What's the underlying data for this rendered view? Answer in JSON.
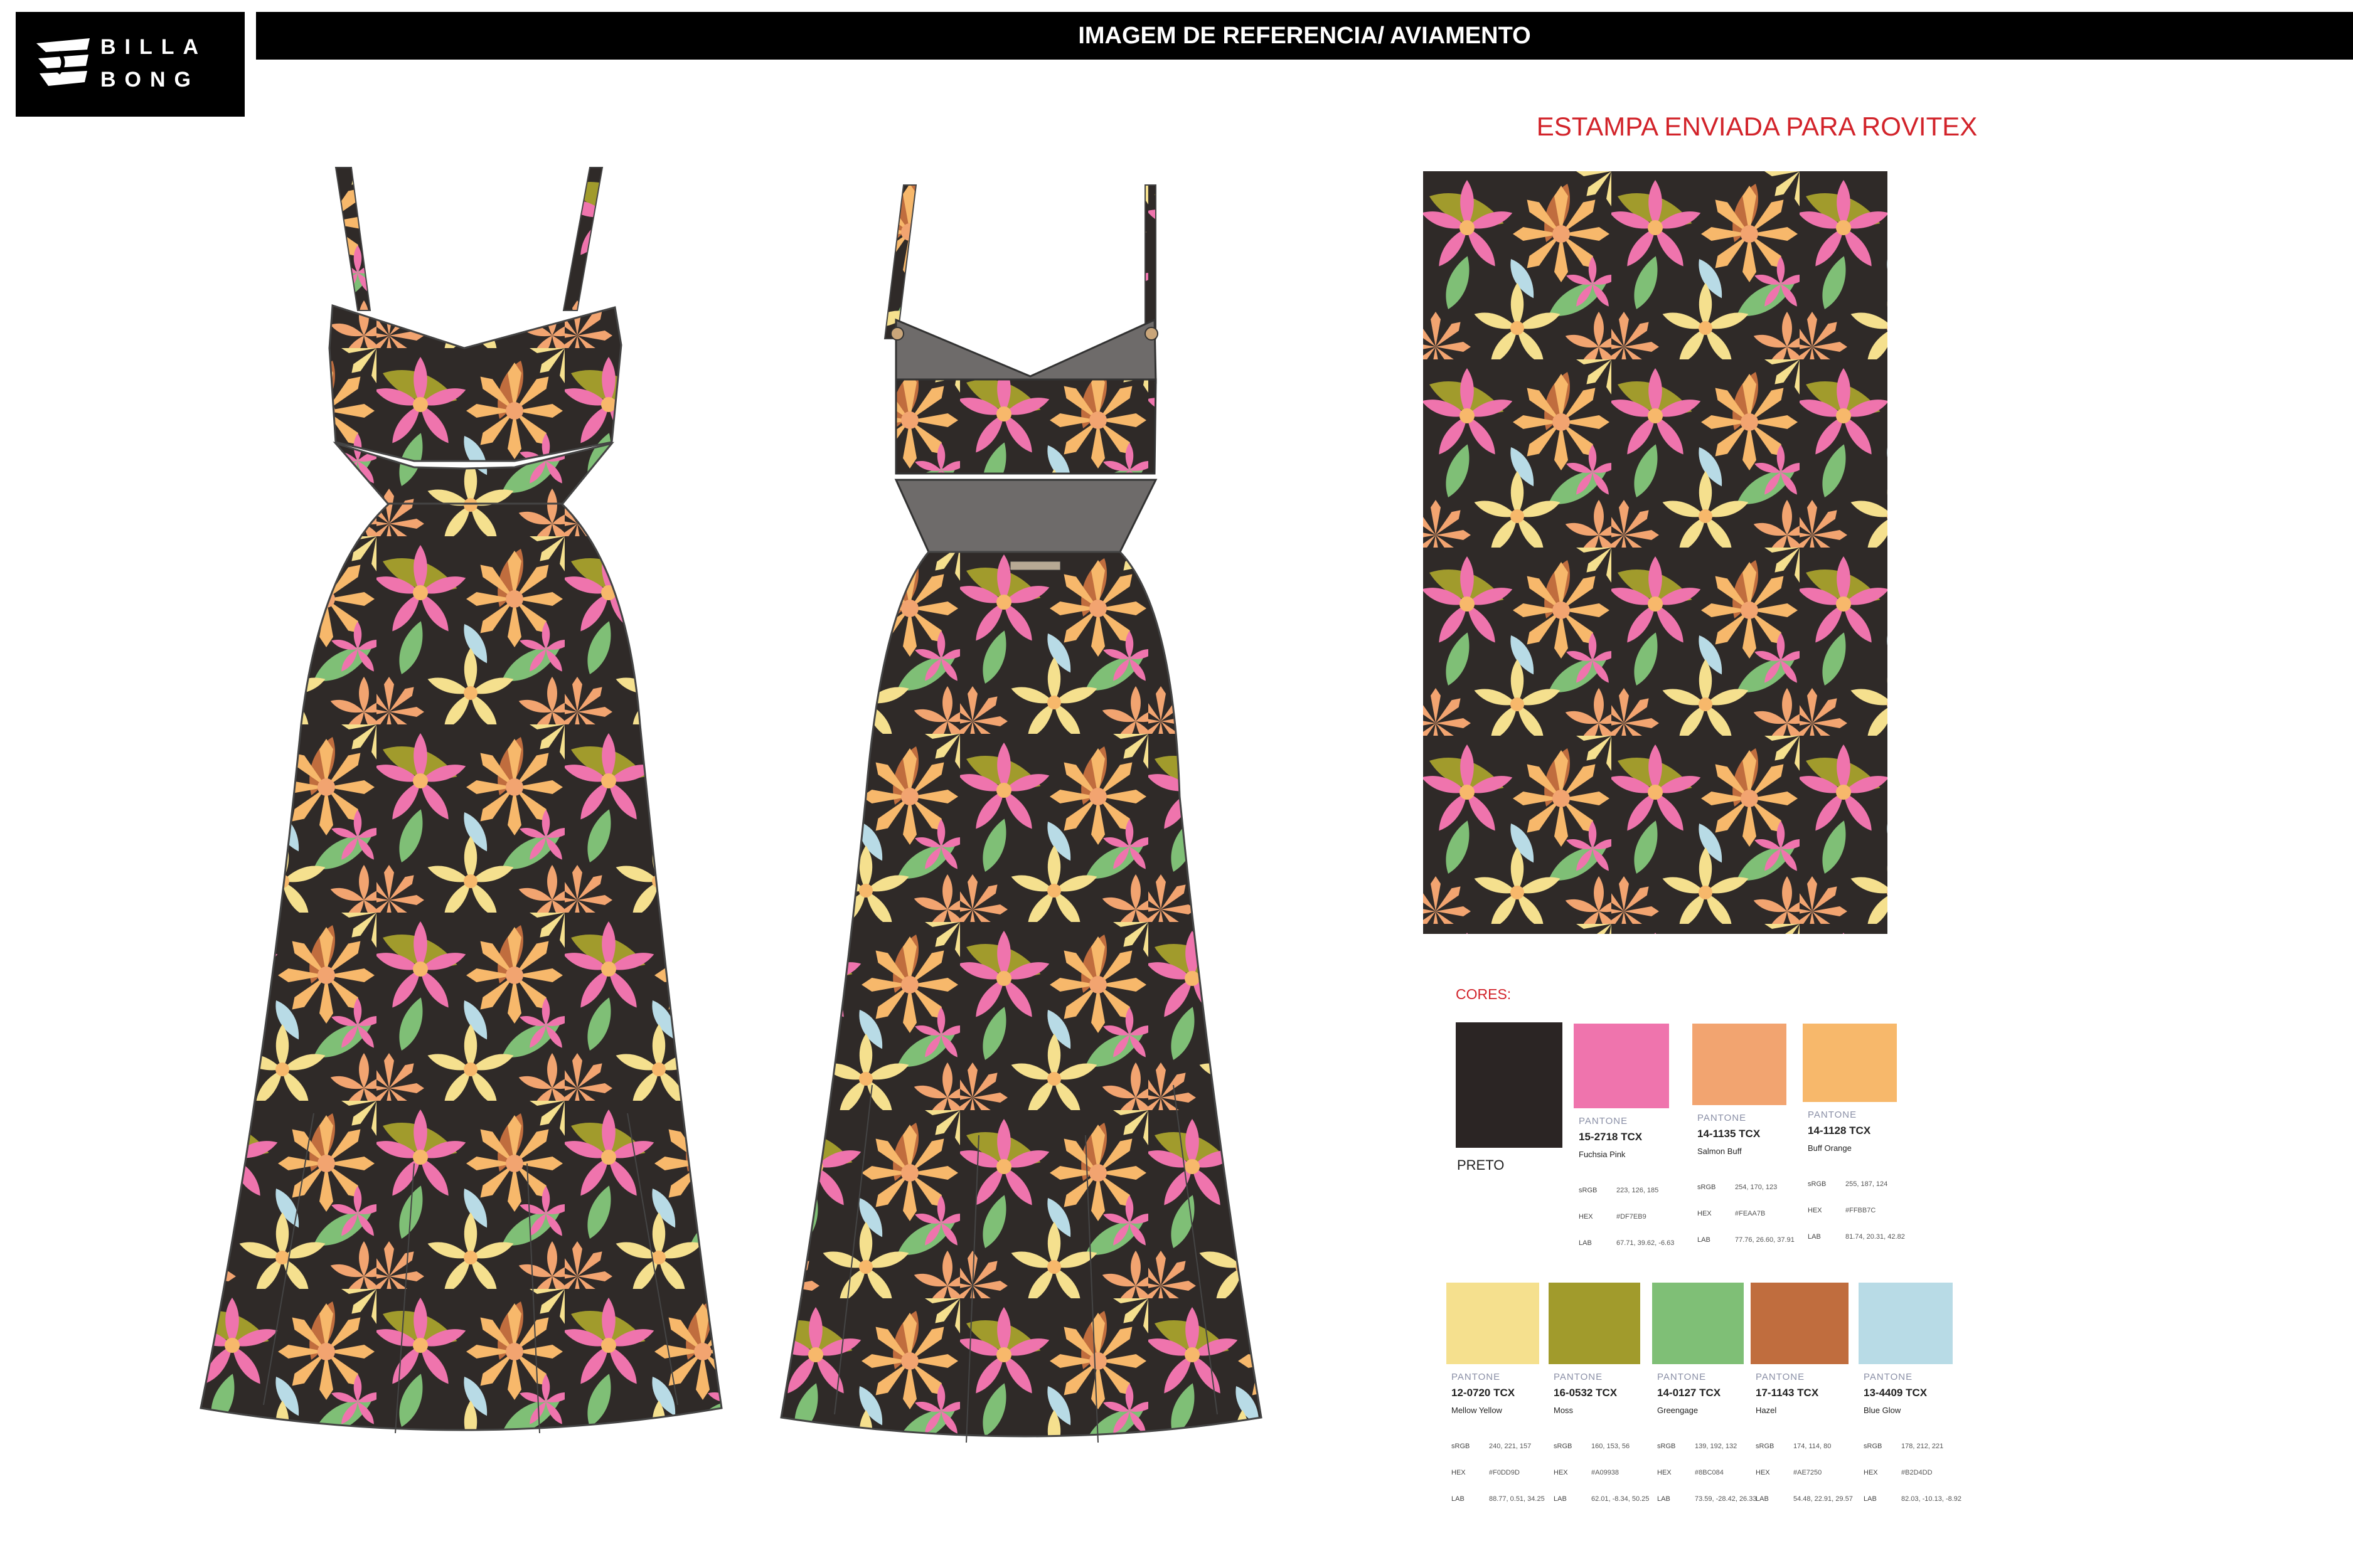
{
  "logo": {
    "line1": "BILLA",
    "line2": "BONG",
    "brand_color": "#000000",
    "icon": "billabong-wave-logo-icon"
  },
  "header": {
    "title": "IMAGEM DE REFERENCIA/ AVIAMENTO"
  },
  "print": {
    "title": "ESTAMPA ENVIADA PARA ROVITEX"
  },
  "palette": {
    "label": "CORES:",
    "swatches": [
      {
        "hex_color": "#2b2524",
        "name": "PRETO",
        "is_plain": true
      },
      {
        "hex_color": "#ef74ad",
        "brand": "PANTONE",
        "code": "15-2718 TCX",
        "name": "Fuchsia Pink",
        "srgb_label": "sRGB",
        "srgb": "223, 126, 185",
        "hex_label": "HEX",
        "hex": "#DF7EB9",
        "lab_label": "LAB",
        "lab": "67.71, 39.62, -6.63"
      },
      {
        "hex_color": "#f2a470",
        "brand": "PANTONE",
        "code": "14-1135 TCX",
        "name": "Salmon Buff",
        "srgb_label": "sRGB",
        "srgb": "254, 170, 123",
        "hex_label": "HEX",
        "hex": "#FEAA7B",
        "lab_label": "LAB",
        "lab": "77.76, 26.60, 37.91"
      },
      {
        "hex_color": "#f7b86b",
        "brand": "PANTONE",
        "code": "14-1128 TCX",
        "name": "Buff Orange",
        "srgb_label": "sRGB",
        "srgb": "255, 187, 124",
        "hex_label": "HEX",
        "hex": "#FFBB7C",
        "lab_label": "LAB",
        "lab": "81.74, 20.31, 42.82"
      },
      {
        "hex_color": "#f5e08e",
        "brand": "PANTONE",
        "code": "12-0720 TCX",
        "name": "Mellow Yellow",
        "srgb_label": "sRGB",
        "srgb": "240, 221, 157",
        "hex_label": "HEX",
        "hex": "#F0DD9D",
        "lab_label": "LAB",
        "lab": "88.77, 0.51, 34.25"
      },
      {
        "hex_color": "#a19b2c",
        "brand": "PANTONE",
        "code": "16-0532 TCX",
        "name": "Moss",
        "srgb_label": "sRGB",
        "srgb": "160, 153, 56",
        "hex_label": "HEX",
        "hex": "#A09938",
        "lab_label": "LAB",
        "lab": "62.01, -8.34, 50.25"
      },
      {
        "hex_color": "#7fbf76",
        "brand": "PANTONE",
        "code": "14-0127 TCX",
        "name": "Greengage",
        "srgb_label": "sRGB",
        "srgb": "139, 192, 132",
        "hex_label": "HEX",
        "hex": "#8BC084",
        "lab_label": "LAB",
        "lab": "73.59, -28.42, 26.33"
      },
      {
        "hex_color": "#c06d3e",
        "brand": "PANTONE",
        "code": "17-1143 TCX",
        "name": "Hazel",
        "srgb_label": "sRGB",
        "srgb": "174, 114, 80",
        "hex_label": "HEX",
        "hex": "#AE7250",
        "lab_label": "LAB",
        "lab": "54.48, 22.91, 29.57"
      },
      {
        "hex_color": "#b8dbe6",
        "brand": "PANTONE",
        "code": "13-4409 TCX",
        "name": "Blue Glow",
        "srgb_label": "sRGB",
        "srgb": "178, 212, 221",
        "hex_label": "HEX",
        "hex": "#B2D4DD",
        "lab_label": "LAB",
        "lab": "82.03, -10.13, -8.92"
      }
    ]
  }
}
